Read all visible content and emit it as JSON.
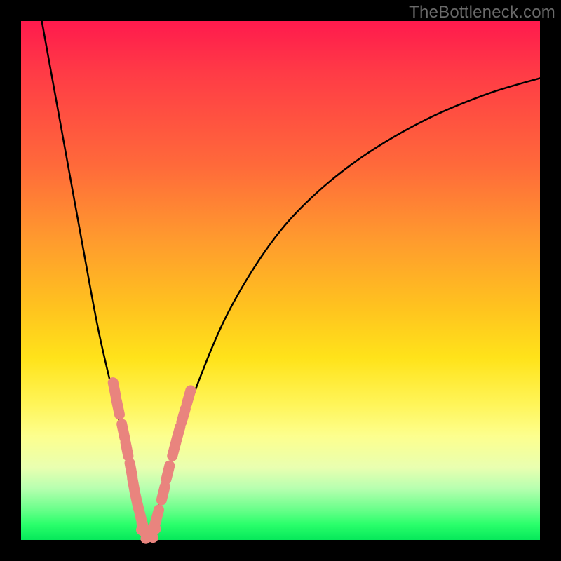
{
  "watermark": {
    "text": "TheBottleneck.com"
  },
  "colors": {
    "frame_bg": "#000000",
    "curve_stroke": "#000000",
    "marker_fill": "#e9847e",
    "marker_stroke": "#c76a64"
  },
  "chart_data": {
    "type": "line",
    "title": "",
    "xlabel": "",
    "ylabel": "",
    "xlim": [
      0,
      100
    ],
    "ylim": [
      0,
      100
    ],
    "grid": false,
    "legend": false,
    "note": "Axes have no visible tick labels; values are relative (0-100). Curve appears to be a V-shaped bottleneck curve with minimum near x≈24.",
    "series": [
      {
        "name": "bottleneck-curve",
        "x": [
          4,
          8,
          12,
          15,
          18,
          20,
          21,
          22,
          23,
          24,
          25,
          26,
          28,
          30,
          34,
          40,
          48,
          56,
          66,
          78,
          90,
          100
        ],
        "values": [
          100,
          78,
          56,
          40,
          27,
          18,
          12,
          7,
          3,
          1,
          2,
          5,
          11,
          18,
          30,
          44,
          57,
          66,
          74,
          81,
          86,
          89
        ]
      }
    ],
    "markers": {
      "name": "highlight-points",
      "note": "Salmon rounded markers clustered near the valley on both branches",
      "points": [
        {
          "x": 18.0,
          "y": 29.0
        },
        {
          "x": 18.7,
          "y": 25.5
        },
        {
          "x": 19.7,
          "y": 21.0
        },
        {
          "x": 20.4,
          "y": 17.5
        },
        {
          "x": 21.2,
          "y": 13.5
        },
        {
          "x": 21.7,
          "y": 10.5
        },
        {
          "x": 22.3,
          "y": 7.5
        },
        {
          "x": 22.8,
          "y": 5.5
        },
        {
          "x": 23.3,
          "y": 3.5
        },
        {
          "x": 23.8,
          "y": 2.0
        },
        {
          "x": 24.3,
          "y": 1.2
        },
        {
          "x": 25.0,
          "y": 1.2
        },
        {
          "x": 25.6,
          "y": 2.5
        },
        {
          "x": 26.2,
          "y": 4.5
        },
        {
          "x": 27.4,
          "y": 9.0
        },
        {
          "x": 28.3,
          "y": 13.0
        },
        {
          "x": 29.5,
          "y": 17.5
        },
        {
          "x": 30.3,
          "y": 20.5
        },
        {
          "x": 31.3,
          "y": 24.0
        },
        {
          "x": 32.3,
          "y": 27.5
        }
      ]
    }
  }
}
